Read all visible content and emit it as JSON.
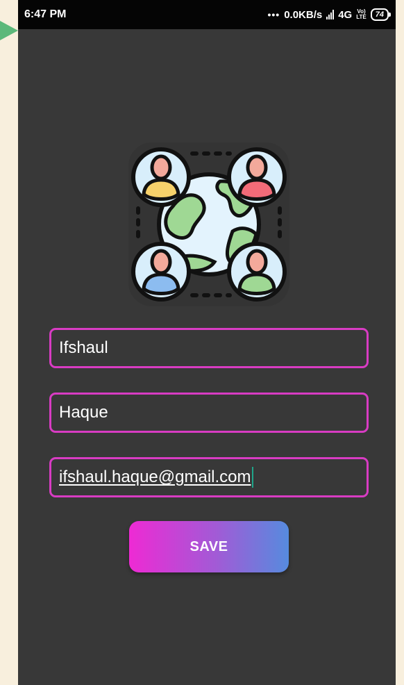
{
  "status_bar": {
    "time": "6:47 PM",
    "dots": "•••",
    "network_speed": "0.0KB/s",
    "network_type": "4G",
    "volte_top": "Vo)",
    "volte_bottom": "LTE",
    "battery": "74"
  },
  "app_logo": {
    "icon": "global-network-people-icon"
  },
  "form": {
    "first_name_value": "Ifshaul",
    "last_name_value": "Haque",
    "email_value": "ifshaul.haque@gmail.com",
    "save_label": "SAVE"
  },
  "colors": {
    "background": "#383838",
    "field_border": "#d83cc3",
    "button_gradient_start": "#ee2ad4",
    "button_gradient_end": "#568bde",
    "cursor": "#1fa58a"
  }
}
